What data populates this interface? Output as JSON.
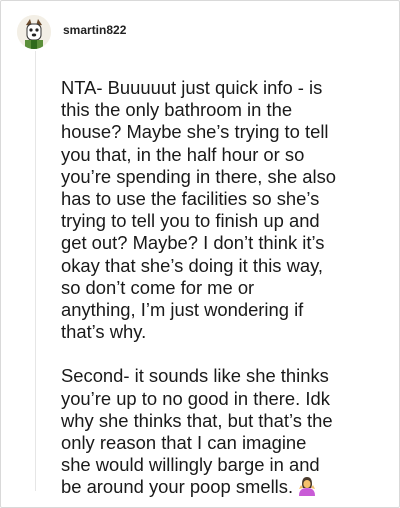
{
  "post": {
    "username": "smartin822",
    "avatar_icon": "dog-cartoon-avatar",
    "paragraphs": [
      "NTA- Buuuuut just quick info - is\nthis the only bathroom in the\nhouse? Maybe she’s trying to tell\nyou that, in the half hour or so\nyou’re spending in there, she also\nhas to use the facilities so she’s\ntrying to tell you to finish up and\nget out? Maybe? I don’t think it’s\nokay that she’s doing it this way,\nso don’t come for me or\nanything, I’m just wondering if\nthat’s why.",
      "Second- it sounds like she thinks\nyou’re up to no good in there. Idk\nwhy she thinks that, but that’s the\nonly reason that I can imagine\nshe would willingly barge in and\nbe around your poop smells."
    ],
    "trailing_emoji": "person-shrugging-icon"
  }
}
